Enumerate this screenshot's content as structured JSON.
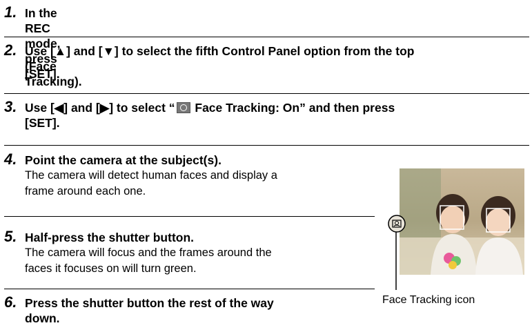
{
  "steps": [
    {
      "num": "1.",
      "title": "In the REC mode, press [SET]."
    },
    {
      "num": "2.",
      "title_line1": "Use [▲] and [▼] to select the fifth Control Panel option from the top",
      "title_line2": "(Face Tracking)."
    },
    {
      "num": "3.",
      "title_pre": "Use [◀] and [▶] to select “",
      "title_post": " Face Tracking: On” and then press",
      "title_line2": "[SET]."
    },
    {
      "num": "4.",
      "title": "Point the camera at the subject(s).",
      "desc_line1": "The camera will detect human faces and display a",
      "desc_line2": "frame around each one."
    },
    {
      "num": "5.",
      "title": "Half-press the shutter button.",
      "desc_line1": "The camera will focus and the frames around the",
      "desc_line2": "faces it focuses on will turn green."
    },
    {
      "num": "6.",
      "title_line1": "Press the shutter button the rest of the way",
      "title_line2": "down."
    }
  ],
  "figure": {
    "callout_label": "Face Tracking icon",
    "icon": "face-tracking-icon"
  }
}
